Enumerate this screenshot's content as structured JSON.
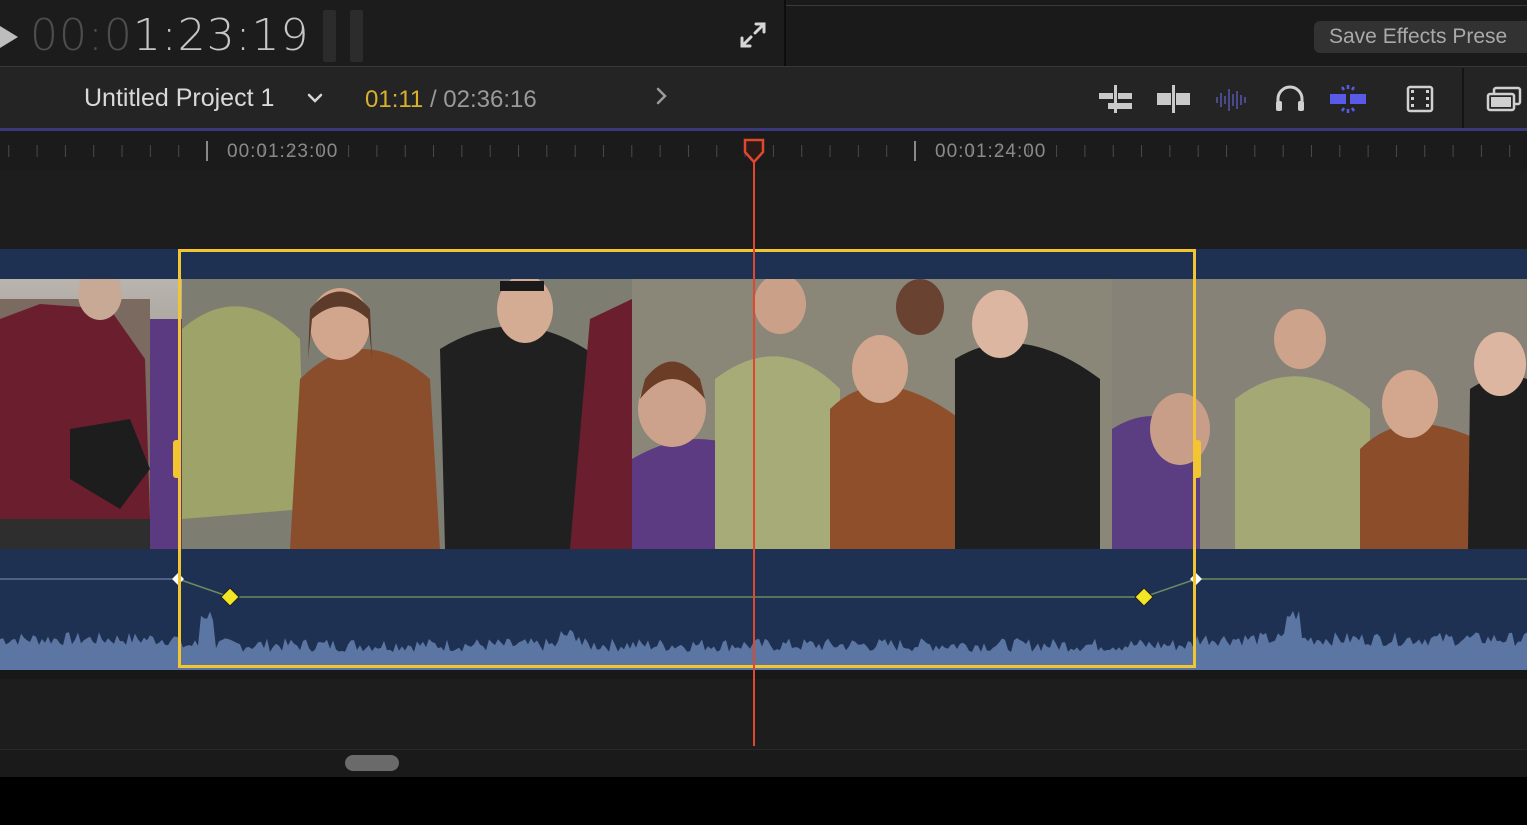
{
  "viewer": {
    "timecode_dim": "00:0",
    "timecode_lit": "1:23:19",
    "save_effects_label": "Save Effects Prese"
  },
  "timeline": {
    "project_title": "Untitled Project 1",
    "position_current": "01:11",
    "position_separator": " / ",
    "position_duration": "02:36:16",
    "tools": [
      {
        "name": "clip-connect-icon"
      },
      {
        "name": "clip-split-icon"
      },
      {
        "name": "audio-waveform-icon"
      },
      {
        "name": "headphones-icon"
      },
      {
        "name": "snapping-icon",
        "active": true
      },
      {
        "name": "filmstrip-icon"
      },
      {
        "name": "clip-appearance-icon"
      }
    ]
  },
  "ruler": {
    "labels": [
      "00:01:23:00",
      "00:01:24:00"
    ]
  },
  "colors": {
    "accent_yellow": "#f2c531",
    "playhead_red": "#e0482d",
    "clip_blue": "#1f3152",
    "waveform": "#5b76a3",
    "timecode_yellow": "#d8b12e",
    "snapping_active": "#5a5ae8"
  }
}
